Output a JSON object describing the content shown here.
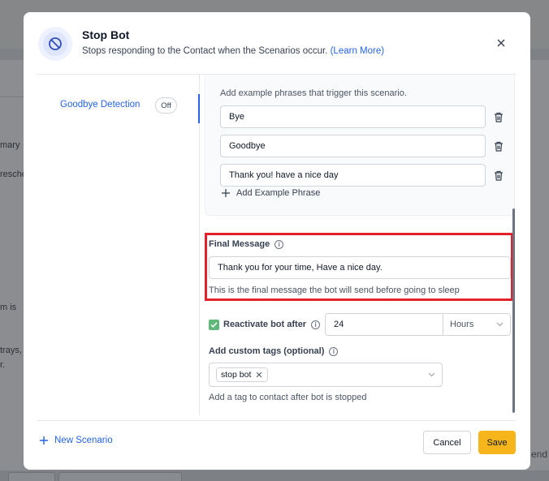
{
  "background": {
    "texts": [
      "mary",
      "resche",
      "m is",
      "trays,",
      "r."
    ],
    "right_text": "end"
  },
  "modal": {
    "title": "Stop Bot",
    "subtitle": "Stops responding to the Contact when the Scenarios occur.",
    "learn_more": "(Learn More)",
    "header_icon": "ban-icon",
    "close_icon": "close-icon"
  },
  "sidebar": {
    "items": [
      {
        "label": "Goodbye Detection",
        "toggle": "Off",
        "active": true
      }
    ]
  },
  "phrases": {
    "hint": "Add example phrases that trigger this scenario.",
    "items": [
      "Bye",
      "Goodbye",
      "Thank you! have a nice day"
    ],
    "add_label": "Add Example Phrase"
  },
  "final_message": {
    "label": "Final Message",
    "value": "Thank you for your time, Have a nice day.",
    "helper": "This is the final message the bot will send before going to sleep"
  },
  "reactivate": {
    "label": "Reactivate bot after",
    "checked": true,
    "value": "24",
    "unit": "Hours"
  },
  "custom_tags": {
    "label": "Add custom tags (optional)",
    "tags": [
      "stop bot"
    ],
    "helper": "Add a tag to contact after bot is stopped"
  },
  "footer": {
    "new_scenario": "New Scenario",
    "cancel": "Cancel",
    "save": "Save"
  },
  "colors": {
    "accent": "#2563eb",
    "save_button": "#f5b51b",
    "highlight": "#e3222b",
    "checkbox": "#5fb879"
  }
}
